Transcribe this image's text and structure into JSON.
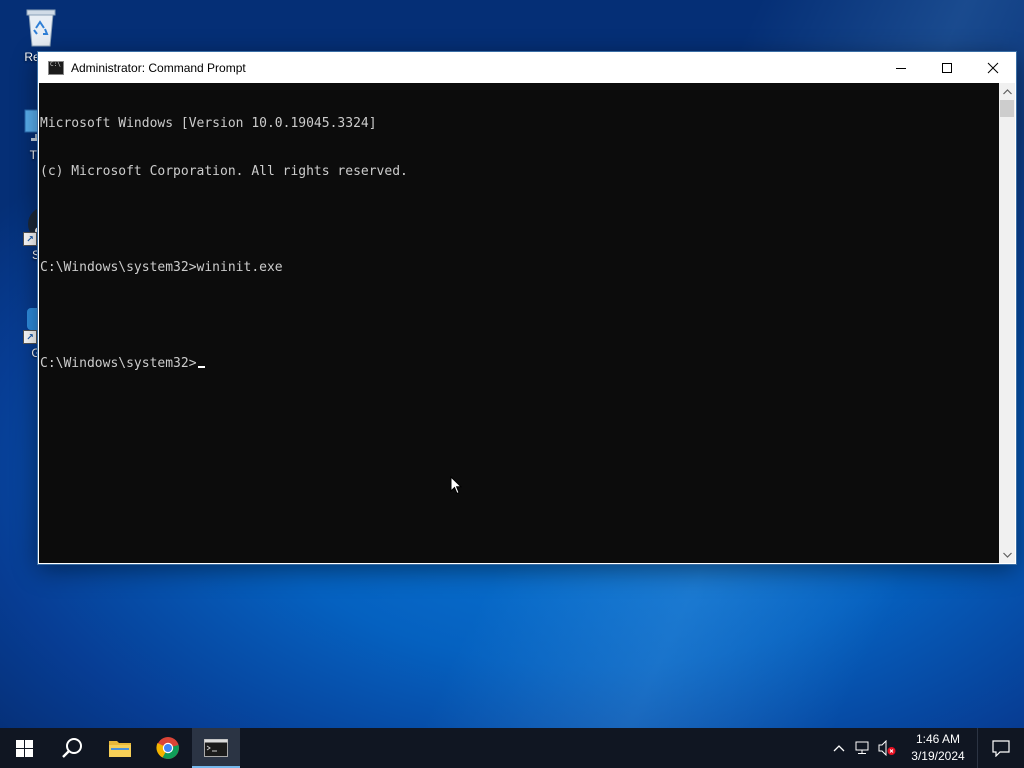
{
  "desktop": {
    "icons": [
      {
        "label": "Recyc"
      },
      {
        "label": "This"
      },
      {
        "label": "Ste"
      },
      {
        "label": "Get"
      }
    ]
  },
  "window": {
    "title": "Administrator: Command Prompt",
    "controls": {
      "minimize": "minimize",
      "maximize": "maximize",
      "close": "close"
    },
    "console_lines": [
      "Microsoft Windows [Version 10.0.19045.3324]",
      "(c) Microsoft Corporation. All rights reserved.",
      "",
      "C:\\Windows\\system32>wininit.exe",
      "",
      "C:\\Windows\\system32>"
    ],
    "colors": {
      "background": "#0c0c0c",
      "text": "#cccccc"
    }
  },
  "taskbar": {
    "items": [
      {
        "icon": "windows-start-icon"
      },
      {
        "icon": "search-icon"
      },
      {
        "icon": "file-explorer-icon"
      },
      {
        "icon": "chrome-icon"
      },
      {
        "icon": "command-prompt-icon",
        "active": true
      }
    ],
    "tray": {
      "icons": [
        "chevron-up-icon",
        "network-icon",
        "volume-muted-icon"
      ],
      "time": "1:46 AM",
      "date": "3/19/2024"
    },
    "accent": "#76b9ed"
  }
}
